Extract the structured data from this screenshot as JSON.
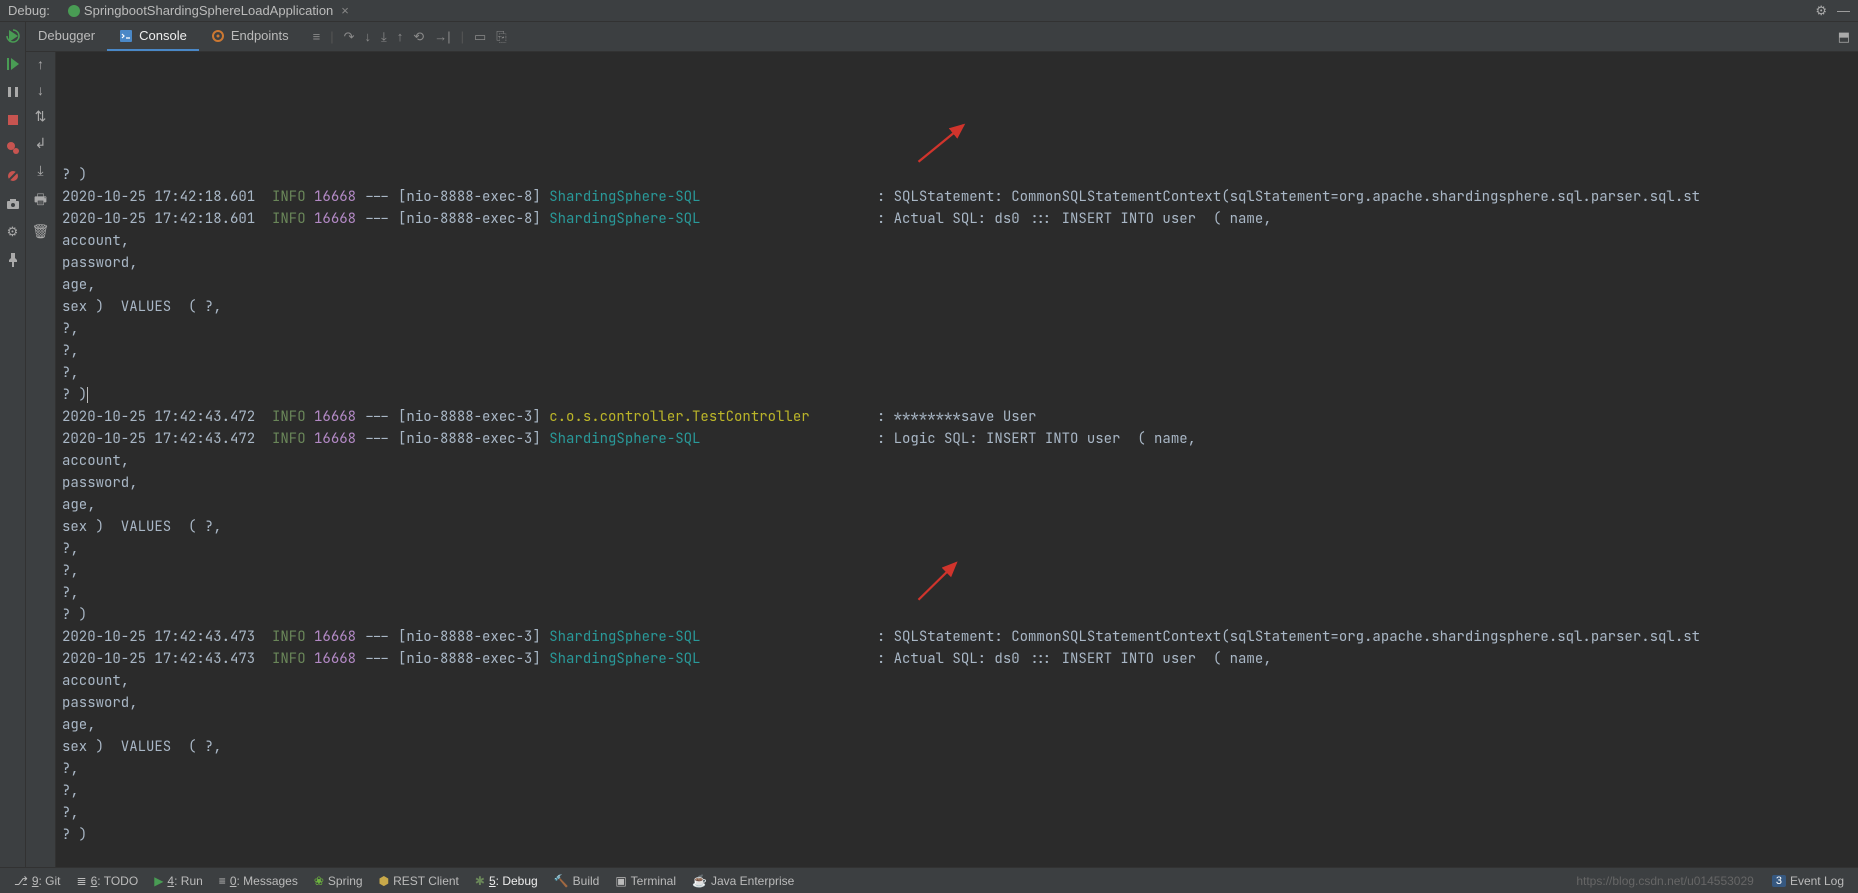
{
  "topbar": {
    "debug_label": "Debug:",
    "app_tab": "SpringbootShardingSphereLoadApplication"
  },
  "debug_tabs": {
    "debugger": "Debugger",
    "console": "Console",
    "endpoints": "Endpoints"
  },
  "log": {
    "lines": [
      {
        "type": "plain",
        "text": "? )"
      },
      {
        "type": "log",
        "ts": "2020-10-25 17:42:18.601",
        "level": "INFO",
        "pid": "16668",
        "thread": " --- [nio-8888-exec-8] ",
        "logger": "ShardingSphere-SQL",
        "loggerClass": "logger-cyan",
        "pad": "                     ",
        "msg": ": SQLStatement: CommonSQLStatementContext(sqlStatement=org.apache.shardingsphere.sql.parser.sql.st"
      },
      {
        "type": "log",
        "ts": "2020-10-25 17:42:18.601",
        "level": "INFO",
        "pid": "16668",
        "thread": " --- [nio-8888-exec-8] ",
        "logger": "ShardingSphere-SQL",
        "loggerClass": "logger-cyan",
        "pad": "                     ",
        "msg": ": Actual SQL: ds0 ::: INSERT INTO user  ( name,"
      },
      {
        "type": "plain",
        "text": "account,"
      },
      {
        "type": "plain",
        "text": "password,"
      },
      {
        "type": "plain",
        "text": "age,"
      },
      {
        "type": "plain",
        "text": "sex )  VALUES  ( ?,"
      },
      {
        "type": "plain",
        "text": "?,"
      },
      {
        "type": "plain",
        "text": "?,"
      },
      {
        "type": "plain",
        "text": "?,"
      },
      {
        "type": "plain",
        "text": "? )"
      },
      {
        "type": "log",
        "ts": "2020-10-25 17:42:43.472",
        "level": "INFO",
        "pid": "16668",
        "thread": " --- [nio-8888-exec-3] ",
        "logger": "c.o.s.controller.TestController",
        "loggerClass": "logger-yellow",
        "pad": "        ",
        "msg": ": ********save User"
      },
      {
        "type": "log",
        "ts": "2020-10-25 17:42:43.472",
        "level": "INFO",
        "pid": "16668",
        "thread": " --- [nio-8888-exec-3] ",
        "logger": "ShardingSphere-SQL",
        "loggerClass": "logger-cyan",
        "pad": "                     ",
        "msg": ": Logic SQL: INSERT INTO user  ( name,"
      },
      {
        "type": "plain",
        "text": "account,"
      },
      {
        "type": "plain",
        "text": "password,"
      },
      {
        "type": "plain",
        "text": "age,"
      },
      {
        "type": "plain",
        "text": "sex )  VALUES  ( ?,"
      },
      {
        "type": "plain",
        "text": "?,"
      },
      {
        "type": "plain",
        "text": "?,"
      },
      {
        "type": "plain",
        "text": "?,"
      },
      {
        "type": "plain",
        "text": "? )"
      },
      {
        "type": "log",
        "ts": "2020-10-25 17:42:43.473",
        "level": "INFO",
        "pid": "16668",
        "thread": " --- [nio-8888-exec-3] ",
        "logger": "ShardingSphere-SQL",
        "loggerClass": "logger-cyan",
        "pad": "                     ",
        "msg": ": SQLStatement: CommonSQLStatementContext(sqlStatement=org.apache.shardingsphere.sql.parser.sql.st"
      },
      {
        "type": "log",
        "ts": "2020-10-25 17:42:43.473",
        "level": "INFO",
        "pid": "16668",
        "thread": " --- [nio-8888-exec-3] ",
        "logger": "ShardingSphere-SQL",
        "loggerClass": "logger-cyan",
        "pad": "                     ",
        "msg": ": Actual SQL: ds0 ::: INSERT INTO user  ( name,"
      },
      {
        "type": "plain",
        "text": "account,"
      },
      {
        "type": "plain",
        "text": "password,"
      },
      {
        "type": "plain",
        "text": "age,"
      },
      {
        "type": "plain",
        "text": "sex )  VALUES  ( ?,"
      },
      {
        "type": "plain",
        "text": "?,"
      },
      {
        "type": "plain",
        "text": "?,"
      },
      {
        "type": "plain",
        "text": "?,"
      },
      {
        "type": "plain",
        "text": "? )"
      }
    ]
  },
  "bottom": {
    "git": "9: Git",
    "todo": "6: TODO",
    "run": "4: Run",
    "messages": "0: Messages",
    "spring": "Spring",
    "rest": "REST Client",
    "debug": "5: Debug",
    "build": "Build",
    "terminal": "Terminal",
    "javaee": "Java Enterprise",
    "url": "https://blog.csdn.net/u014553029",
    "eventlog_badge": "3",
    "eventlog": "Event Log"
  },
  "colors": {
    "accent_red_arrow": "#d0342c"
  }
}
